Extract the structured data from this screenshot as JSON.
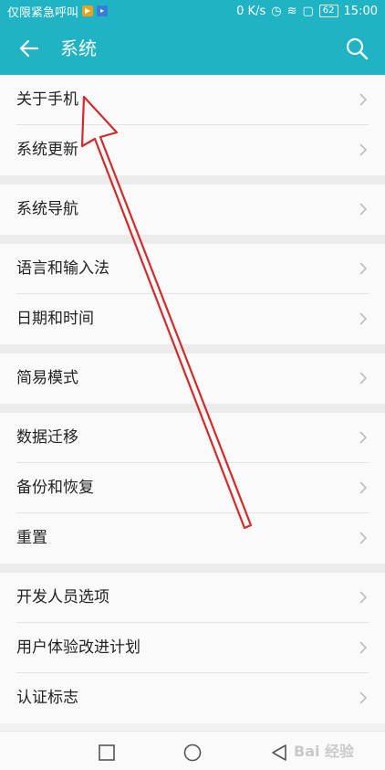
{
  "status_bar": {
    "left_text": "仅限紧急呼叫",
    "network_speed": "0 K/s",
    "battery": "62",
    "time": "15:00"
  },
  "app_bar": {
    "title": "系统"
  },
  "groups": [
    [
      "关于手机",
      "系统更新"
    ],
    [
      "系统导航"
    ],
    [
      "语言和输入法",
      "日期和时间"
    ],
    [
      "简易模式"
    ],
    [
      "数据迁移",
      "备份和恢复",
      "重置"
    ],
    [
      "开发人员选项",
      "用户体验改进计划",
      "认证标志"
    ]
  ],
  "watermark": "Bai 经验",
  "colors": {
    "accent": "#1fb3c3",
    "annotation": "#d42a2a"
  }
}
